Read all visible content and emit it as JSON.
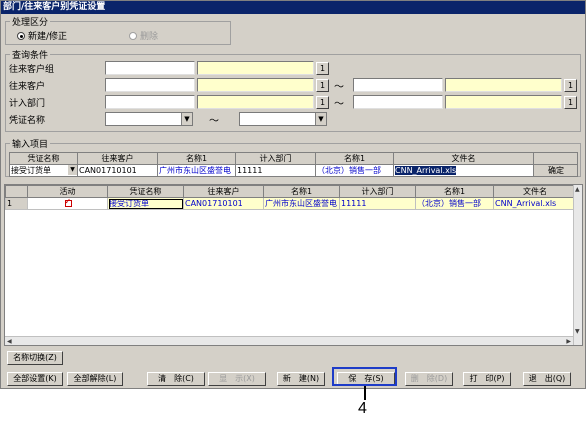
{
  "window": {
    "title": "部门/往来客户别凭证设置"
  },
  "process": {
    "legend": "处理区分",
    "options": [
      {
        "label": "新建/修正",
        "selected": true,
        "enabled": true
      },
      {
        "label": "删除",
        "selected": false,
        "enabled": false
      }
    ]
  },
  "query": {
    "legend": "查询条件",
    "rows": [
      {
        "label": "往来客户组",
        "btn": "1"
      },
      {
        "label": "往来客户",
        "btn": "1",
        "tilde": "～",
        "btn2": "1"
      },
      {
        "label": "计入部门",
        "btn": "1",
        "tilde": "～",
        "btn2": "1"
      },
      {
        "label": "凭证名称",
        "tilde": "～"
      }
    ]
  },
  "input_items": {
    "legend": "输入项目",
    "headers": [
      "凭证名称",
      "往来客户",
      "名称1",
      "计入部门",
      "名称1",
      "文件名",
      ""
    ],
    "row": [
      "接受订货单",
      "CAN01710101",
      "广州市东山区盛誉电",
      "11111",
      "（北京）销售一部",
      "CNN_Arrival.xls",
      "确定"
    ]
  },
  "grid": {
    "headers": [
      "",
      "活动",
      "凭证名称",
      "往来客户",
      "名称1",
      "计入部门",
      "名称1",
      "文件名"
    ],
    "rows": [
      {
        "num": "1",
        "active": true,
        "cells": [
          "接受订货单",
          "CAN01710101",
          "广州市东山区盛誉电",
          "11111",
          "（北京）销售一部",
          "CNN_Arrival.xls"
        ]
      }
    ]
  },
  "buttons": {
    "name_switch": "名称切换(Z)",
    "set_all": "全部设置(K)",
    "clear_all": "全部解除(L)",
    "clear": "清　除(C)",
    "display": "显　示(X)",
    "new": "新　建(N)",
    "save": "保　存(S)",
    "delete": "删　除(D)",
    "print": "打　印(P)",
    "exit": "退　出(Q)"
  },
  "callout": {
    "number": "4"
  },
  "colors": {
    "title_bg": "#0a246a",
    "field_yellow": "#ffffcc",
    "highlight": "#1e3cc8",
    "link_blue": "#0000cc"
  }
}
